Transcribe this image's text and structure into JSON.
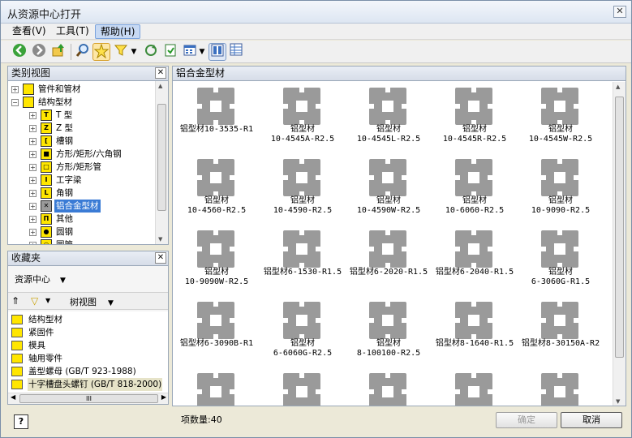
{
  "window": {
    "title": "从资源中心打开",
    "close": "✕"
  },
  "menu": [
    {
      "label": "查看(V)"
    },
    {
      "label": "工具(T)"
    },
    {
      "label": "帮助(H)"
    }
  ],
  "toolbar": {
    "icons": [
      "back-icon",
      "forward-icon",
      "up-folder-icon",
      "search-icon",
      "favorites-icon",
      "filter-icon",
      "dropdown-arrow-icon",
      "refresh-icon",
      "update-icon",
      "view-options-icon",
      "dropdown-arrow-icon",
      "list-view-icon",
      "table-view-icon"
    ]
  },
  "category": {
    "title": "类别视图",
    "close": "✕",
    "items": [
      {
        "label": "管件和管材",
        "level": 1,
        "exp": "+"
      },
      {
        "label": "结构型材",
        "level": 1,
        "exp": "−"
      },
      {
        "label": "T 型",
        "level": 2,
        "exp": "+",
        "icon": "T"
      },
      {
        "label": "Z 型",
        "level": 2,
        "exp": "+",
        "icon": "Z"
      },
      {
        "label": "槽钢",
        "level": 2,
        "exp": "+",
        "icon": "["
      },
      {
        "label": "方形/矩形/六角钢",
        "level": 2,
        "exp": "+",
        "icon": "■"
      },
      {
        "label": "方形/矩形管",
        "level": 2,
        "exp": "+",
        "icon": "□"
      },
      {
        "label": "工字梁",
        "level": 2,
        "exp": "+",
        "icon": "I"
      },
      {
        "label": "角钢",
        "level": 2,
        "exp": "+",
        "icon": "L"
      },
      {
        "label": "铝合金型材",
        "level": 2,
        "exp": "+",
        "icon": "✕",
        "selected": true
      },
      {
        "label": "其他",
        "level": 2,
        "exp": "+",
        "icon": "Π"
      },
      {
        "label": "圆钢",
        "level": 2,
        "exp": "+",
        "icon": "●"
      },
      {
        "label": "圆管",
        "level": 2,
        "exp": "+",
        "icon": "○"
      }
    ]
  },
  "favorites": {
    "title": "收藏夹",
    "close": "✕",
    "source": "资源中心",
    "view": "树视图",
    "items": [
      {
        "label": "结构型材"
      },
      {
        "label": "紧固件"
      },
      {
        "label": "模具"
      },
      {
        "label": "轴用零件"
      },
      {
        "label": "盖型螺母 (GB/T 923-1988)"
      },
      {
        "label": "十字槽盘头螺钉 (GB/T 818-2000)",
        "highlight": true
      }
    ],
    "hscroll": "III"
  },
  "main": {
    "title": "铝合金型材",
    "items": [
      {
        "l1": "铝型材10-3535-R1",
        "l2": ""
      },
      {
        "l1": "铝型材",
        "l2": "10-4545A-R2.5"
      },
      {
        "l1": "铝型材",
        "l2": "10-4545L-R2.5"
      },
      {
        "l1": "铝型材",
        "l2": "10-4545R-R2.5"
      },
      {
        "l1": "铝型材",
        "l2": "10-4545W-R2.5"
      },
      {
        "l1": "铝型材",
        "l2": "10-4560-R2.5"
      },
      {
        "l1": "铝型材",
        "l2": "10-4590-R2.5"
      },
      {
        "l1": "铝型材",
        "l2": "10-4590W-R2.5"
      },
      {
        "l1": "铝型材",
        "l2": "10-6060-R2.5"
      },
      {
        "l1": "铝型材",
        "l2": "10-9090-R2.5"
      },
      {
        "l1": "铝型材",
        "l2": "10-9090W-R2.5"
      },
      {
        "l1": "铝型材6-1530-R1.5",
        "l2": ""
      },
      {
        "l1": "铝型材6-2020-R1.5",
        "l2": ""
      },
      {
        "l1": "铝型材6-2040-R1.5",
        "l2": ""
      },
      {
        "l1": "铝型材",
        "l2": "6-3060G-R1.5"
      },
      {
        "l1": "铝型材6-3090B-R1",
        "l2": ""
      },
      {
        "l1": "铝型材",
        "l2": "6-6060G-R2.5"
      },
      {
        "l1": "铝型材",
        "l2": "8-100100-R2.5"
      },
      {
        "l1": "铝型材8-1640-R1.5",
        "l2": ""
      },
      {
        "l1": "铝型材8-30150A-R2",
        "l2": ""
      },
      {
        "l1": "",
        "l2": ""
      },
      {
        "l1": "",
        "l2": ""
      },
      {
        "l1": "",
        "l2": ""
      },
      {
        "l1": "",
        "l2": ""
      },
      {
        "l1": "",
        "l2": ""
      }
    ]
  },
  "status": {
    "help": "?",
    "count": "项数量:40",
    "ok": "确定",
    "cancel": "取消"
  }
}
